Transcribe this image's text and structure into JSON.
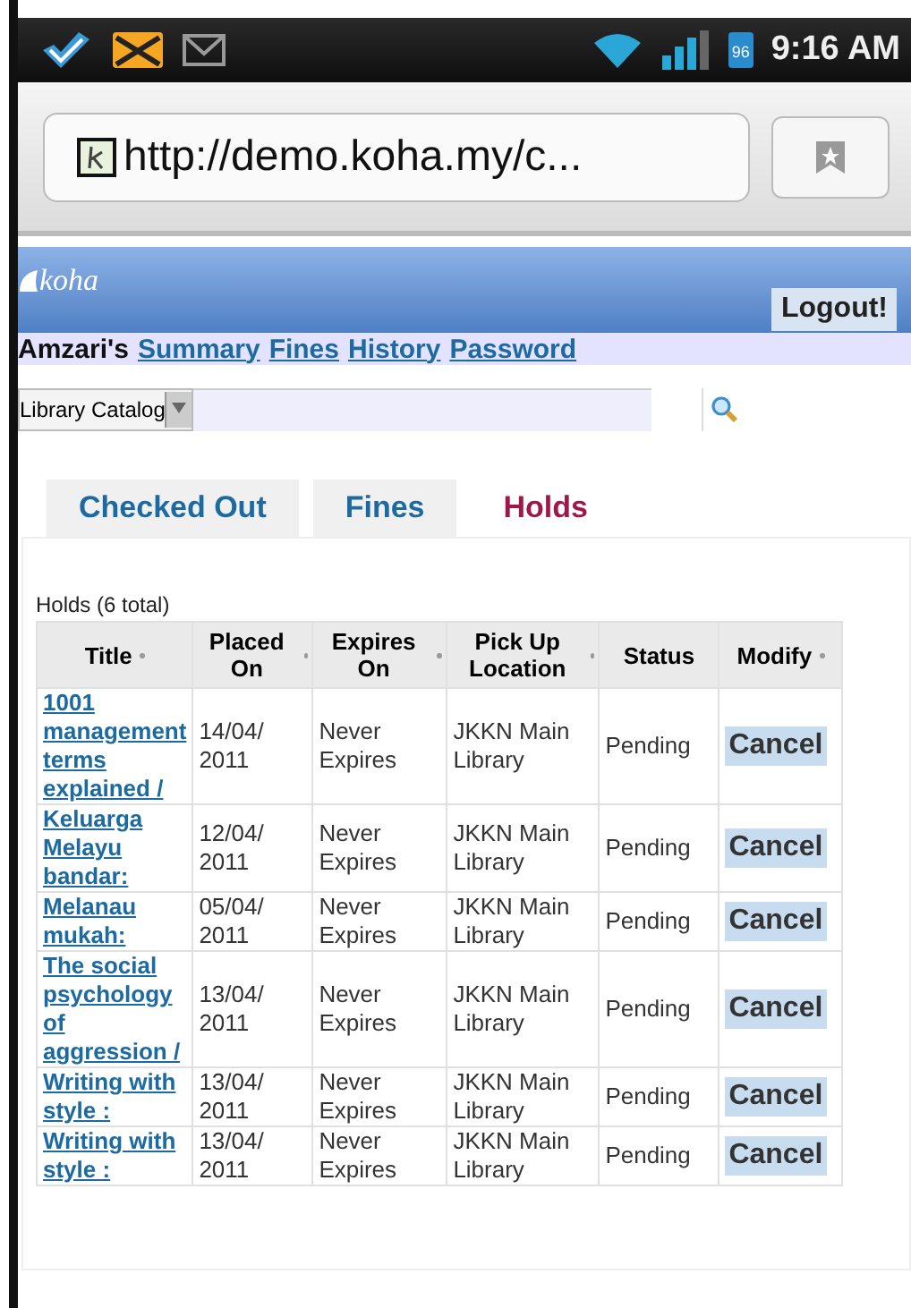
{
  "status_bar": {
    "battery": "96",
    "time": "9:16 AM"
  },
  "browser": {
    "url": "http://demo.koha.my/c..."
  },
  "header": {
    "logo": "koha",
    "logout": "Logout!"
  },
  "nav": {
    "owner": "Amzari's",
    "links": [
      "Summary",
      "Fines",
      "History",
      "Password"
    ]
  },
  "search": {
    "scope": "Library Catalog"
  },
  "tabs": [
    {
      "label": "Checked Out",
      "selected": false
    },
    {
      "label": "Fines",
      "selected": false
    },
    {
      "label": "Holds",
      "selected": true
    }
  ],
  "holds": {
    "caption": "Holds (6 total)",
    "columns": [
      "Title",
      "Placed On",
      "Expires On",
      "Pick Up Location",
      "Status",
      "Modify"
    ],
    "rows": [
      {
        "title": "1001 management terms explained /",
        "placed": "14/04/ 2011",
        "expires": "Never Expires",
        "location": "JKKN Main Library",
        "status": "Pending",
        "action": "Cancel"
      },
      {
        "title": "Keluarga Melayu bandar:",
        "placed": "12/04/ 2011",
        "expires": "Never Expires",
        "location": "JKKN Main Library",
        "status": "Pending",
        "action": "Cancel"
      },
      {
        "title": "Melanau mukah:",
        "placed": "05/04/ 2011",
        "expires": "Never Expires",
        "location": "JKKN Main Library",
        "status": "Pending",
        "action": "Cancel"
      },
      {
        "title": "The social psychology of aggression /",
        "placed": "13/04/ 2011",
        "expires": "Never Expires",
        "location": "JKKN Main Library",
        "status": "Pending",
        "action": "Cancel"
      },
      {
        "title": "Writing with style :",
        "placed": "13/04/ 2011",
        "expires": "Never Expires",
        "location": "JKKN Main Library",
        "status": "Pending",
        "action": "Cancel"
      },
      {
        "title": "Writing with style :",
        "placed": "13/04/ 2011",
        "expires": "Never Expires",
        "location": "JKKN Main Library",
        "status": "Pending",
        "action": "Cancel"
      }
    ]
  }
}
